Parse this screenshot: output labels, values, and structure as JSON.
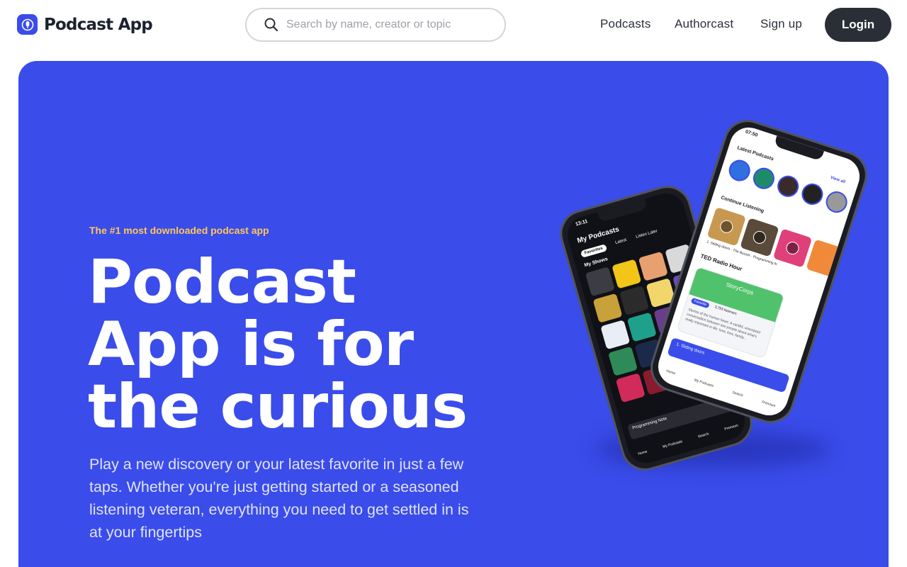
{
  "header": {
    "brand": "Podcast App",
    "search": {
      "placeholder": "Search by name, creator or topic"
    },
    "nav": [
      "Podcasts",
      "Authorcast",
      "Sign up"
    ],
    "login_label": "Login"
  },
  "hero": {
    "eyebrow": "The #1 most downloaded podcast app",
    "headline": "Podcast App is for the curious",
    "description": "Play a new discovery or your latest favorite in just a few taps. Whether you're just getting started or a seasoned listening veteran, everything you need to get settled in is at your fingertips"
  },
  "phone_back": {
    "time": "13:11",
    "title": "My Podcasts",
    "tabs": [
      "Favorites",
      "Latest",
      "Listen Later"
    ],
    "section": "My Shows",
    "player_title": "Programming Note",
    "tabbar": [
      "Home",
      "My Podcasts",
      "Search",
      "Premium"
    ]
  },
  "phone_front": {
    "time": "07:50",
    "section_latest": "Latest Podcasts",
    "view_all": "View all",
    "section_continue": "Continue Listening",
    "episodes": [
      "1. Sliding doors",
      "The Buzzer",
      "Programming N"
    ],
    "channel": "TED Radio Hour",
    "card_title": "StoryCorps",
    "card_button": "Favorite",
    "card_count": "3,793 listeners",
    "card_text": "Stories of the human heart. A candid, unscripted conversation between two people about what's really important in life: love, loss, family...",
    "player_title": "1. Sliding doors",
    "tabbar": [
      "Home",
      "My Podcasts",
      "Search",
      "Premium"
    ]
  },
  "colors": {
    "accent": "#3a4cea",
    "eyebrow": "#ffc857",
    "login_bg": "#2a2f37"
  },
  "icons": [
    "microphone-logo-icon",
    "search-icon"
  ]
}
